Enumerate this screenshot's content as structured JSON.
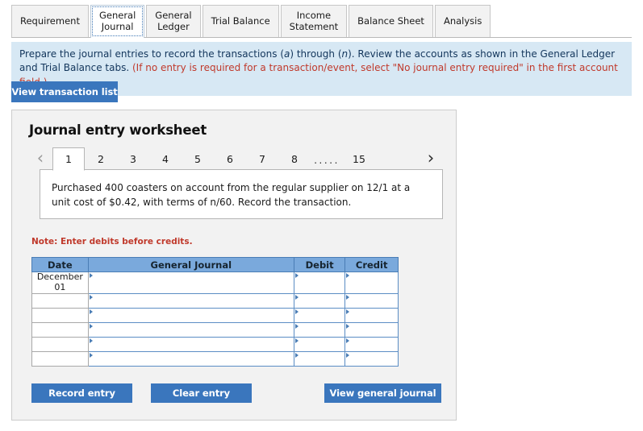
{
  "tabs": [
    {
      "label": "Requirement",
      "active": false
    },
    {
      "label": "General\nJournal",
      "active": true
    },
    {
      "label": "General\nLedger",
      "active": false
    },
    {
      "label": "Trial Balance",
      "active": false
    },
    {
      "label": "Income\nStatement",
      "active": false
    },
    {
      "label": "Balance Sheet",
      "active": false
    },
    {
      "label": "Analysis",
      "active": false
    }
  ],
  "banner": {
    "line1_part1": "Prepare the journal entries to record the transactions (",
    "line1_italic_a": "a",
    "line1_part2": ") through (",
    "line1_italic_n": "n",
    "line1_part3": "). Review the accounts as shown in the General Ledger and Trial Balance tabs. ",
    "red_text": "(If no entry is required for a transaction/event, select \"No journal entry required\" in the first account field.)"
  },
  "toolbar": {
    "view_transaction_list_label": "View transaction list"
  },
  "worksheet": {
    "title": "Journal entry worksheet",
    "pager": {
      "prev_icon": "chevron-left-icon",
      "next_icon": "chevron-right-icon",
      "pages": [
        "1",
        "2",
        "3",
        "4",
        "5",
        "6",
        "7",
        "8"
      ],
      "ellipsis": ".....",
      "last_page": "15",
      "active_page": "1"
    },
    "transaction_text": "Purchased 400 coasters on account from the regular supplier on 12/1 at a unit cost of $0.42, with terms of n/60. Record the transaction.",
    "note": "Note: Enter debits before credits.",
    "table": {
      "headers": [
        "Date",
        "General Journal",
        "Debit",
        "Credit"
      ],
      "rows": [
        {
          "date": "December\n01",
          "journal": "",
          "debit": "",
          "credit": ""
        },
        {
          "date": "",
          "journal": "",
          "debit": "",
          "credit": ""
        },
        {
          "date": "",
          "journal": "",
          "debit": "",
          "credit": ""
        },
        {
          "date": "",
          "journal": "",
          "debit": "",
          "credit": ""
        },
        {
          "date": "",
          "journal": "",
          "debit": "",
          "credit": ""
        },
        {
          "date": "",
          "journal": "",
          "debit": "",
          "credit": ""
        }
      ]
    },
    "buttons": {
      "record_entry": "Record entry",
      "clear_entry": "Clear entry",
      "view_general_journal": "View general journal"
    }
  },
  "colors": {
    "accent_blue": "#3a76bd",
    "header_blue": "#7aa9dc",
    "banner_blue": "#d7e8f4",
    "note_red": "#c0392b",
    "card_gray": "#f2f2f2"
  }
}
